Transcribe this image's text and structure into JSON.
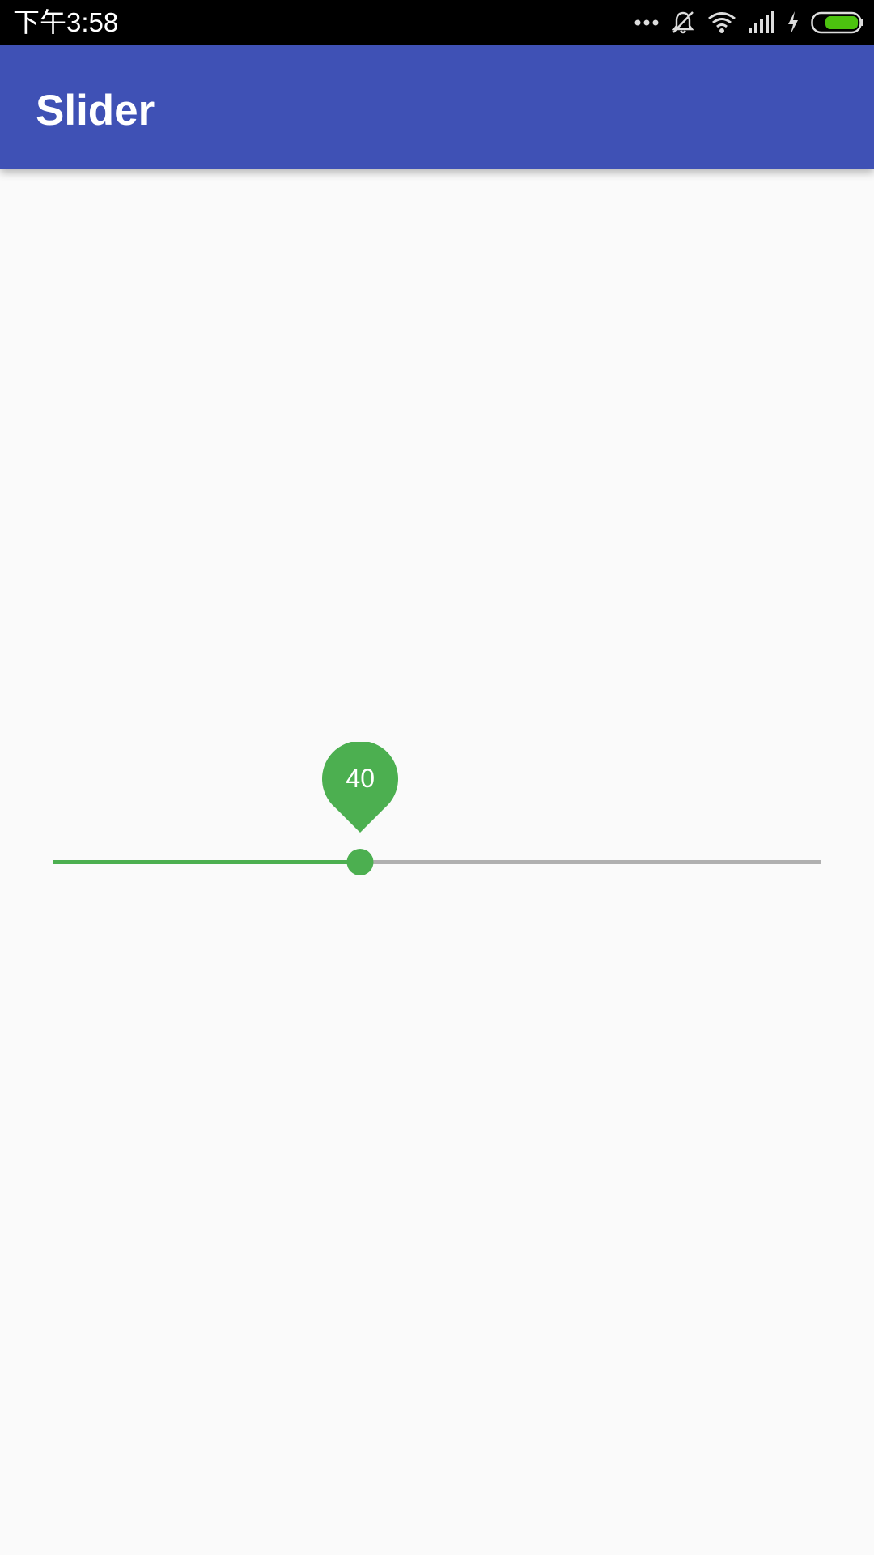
{
  "status_bar": {
    "time": "下午3:58",
    "icons": [
      "more-dots-icon",
      "notifications-off-icon",
      "wifi-icon",
      "signal-icon",
      "charging-icon",
      "battery-icon"
    ]
  },
  "app_bar": {
    "title": "Slider",
    "color": "#3F51B5"
  },
  "slider": {
    "value": 40,
    "value_label": "40",
    "min": 0,
    "max": 100,
    "active_color": "#4CAF50",
    "inactive_color": "#B0B0B0"
  }
}
